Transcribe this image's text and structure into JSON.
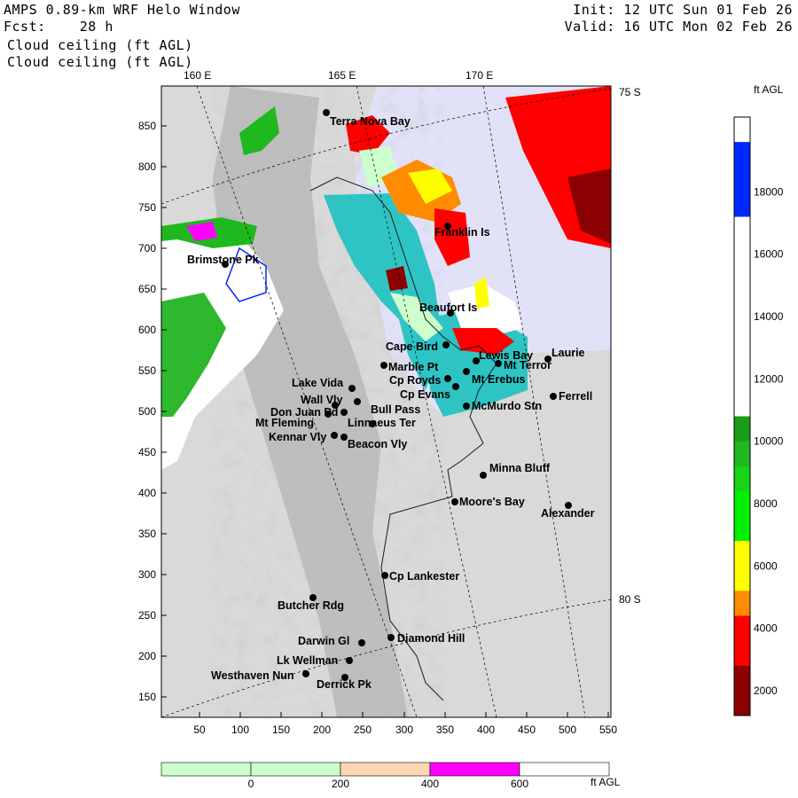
{
  "header": {
    "title": "AMPS 0.89-km WRF Helo Window",
    "forecast": "Fcst:    28 h",
    "field_line1": "Cloud ceiling (ft AGL)",
    "field_line2": "Cloud ceiling (ft AGL)",
    "init": "Init: 12 UTC Sun 01 Feb 26",
    "valid": "Valid: 16 UTC Mon 02 Feb 26"
  },
  "map": {
    "x_ticks": [
      "50",
      "100",
      "150",
      "200",
      "250",
      "300",
      "350",
      "400",
      "450",
      "500",
      "550"
    ],
    "y_ticks": [
      "850",
      "800",
      "750",
      "700",
      "650",
      "600",
      "550",
      "500",
      "450",
      "400",
      "350",
      "300",
      "250",
      "200",
      "150"
    ],
    "lon_labels": [
      "160 E",
      "165 E",
      "170 E"
    ],
    "lat_labels": [
      "75 S",
      "80 S"
    ],
    "places": [
      {
        "name": "Terra Nova Bay"
      },
      {
        "name": "Franklin Is"
      },
      {
        "name": "Brimstone Pk"
      },
      {
        "name": "Beaufort Is"
      },
      {
        "name": "Cape Bird"
      },
      {
        "name": "Lewis Bay"
      },
      {
        "name": "Laurie"
      },
      {
        "name": "Mt Terror"
      },
      {
        "name": "Marble Pt"
      },
      {
        "name": "Cp Royds"
      },
      {
        "name": "Mt Erebus"
      },
      {
        "name": "Lake Vida"
      },
      {
        "name": "Cp Evans"
      },
      {
        "name": "Ferrell"
      },
      {
        "name": "Wall Vly"
      },
      {
        "name": "Bull Pass"
      },
      {
        "name": "McMurdo Stn"
      },
      {
        "name": "Don Juan Pd"
      },
      {
        "name": "Mt Fleming"
      },
      {
        "name": "Linnaeus Ter"
      },
      {
        "name": "Kennar Vly"
      },
      {
        "name": "Beacon Vly"
      },
      {
        "name": "Minna Bluff"
      },
      {
        "name": "Moore's Bay"
      },
      {
        "name": "Alexander"
      },
      {
        "name": "Cp Lankester"
      },
      {
        "name": "Butcher Rdg"
      },
      {
        "name": "Darwin Gl"
      },
      {
        "name": "Diamond Hill"
      },
      {
        "name": "Lk Wellman"
      },
      {
        "name": "Westhaven Nun"
      },
      {
        "name": "Derrick Pk"
      }
    ]
  },
  "colorbar_right": {
    "unit": "ft AGL",
    "labels": [
      "18000",
      "16000",
      "14000",
      "12000",
      "10000",
      "8000",
      "6000",
      "4000",
      "2000"
    ],
    "colors": [
      "#ffffff",
      "#0028ff",
      "#0028ff",
      "#0028ff",
      "#ffffff",
      "#ffffff",
      "#ffffff",
      "#ffffff",
      "#ffffff",
      "#ffffff",
      "#ffffff",
      "#ffffff",
      "#1a9e1a",
      "#1fb81f",
      "#19d319",
      "#00f000",
      "#00f000",
      "#ffff00",
      "#ffff00",
      "#ff8c00",
      "#ff0000",
      "#ff0000",
      "#8b0000",
      "#8b0000"
    ]
  },
  "colorbar_bottom": {
    "unit": "ft AGL",
    "labels": [
      "0",
      "200",
      "400",
      "600"
    ],
    "colors": [
      "#ccffcc",
      "#ccffcc",
      "#ffd7b5",
      "#ff00ff",
      "#ffffff"
    ]
  }
}
